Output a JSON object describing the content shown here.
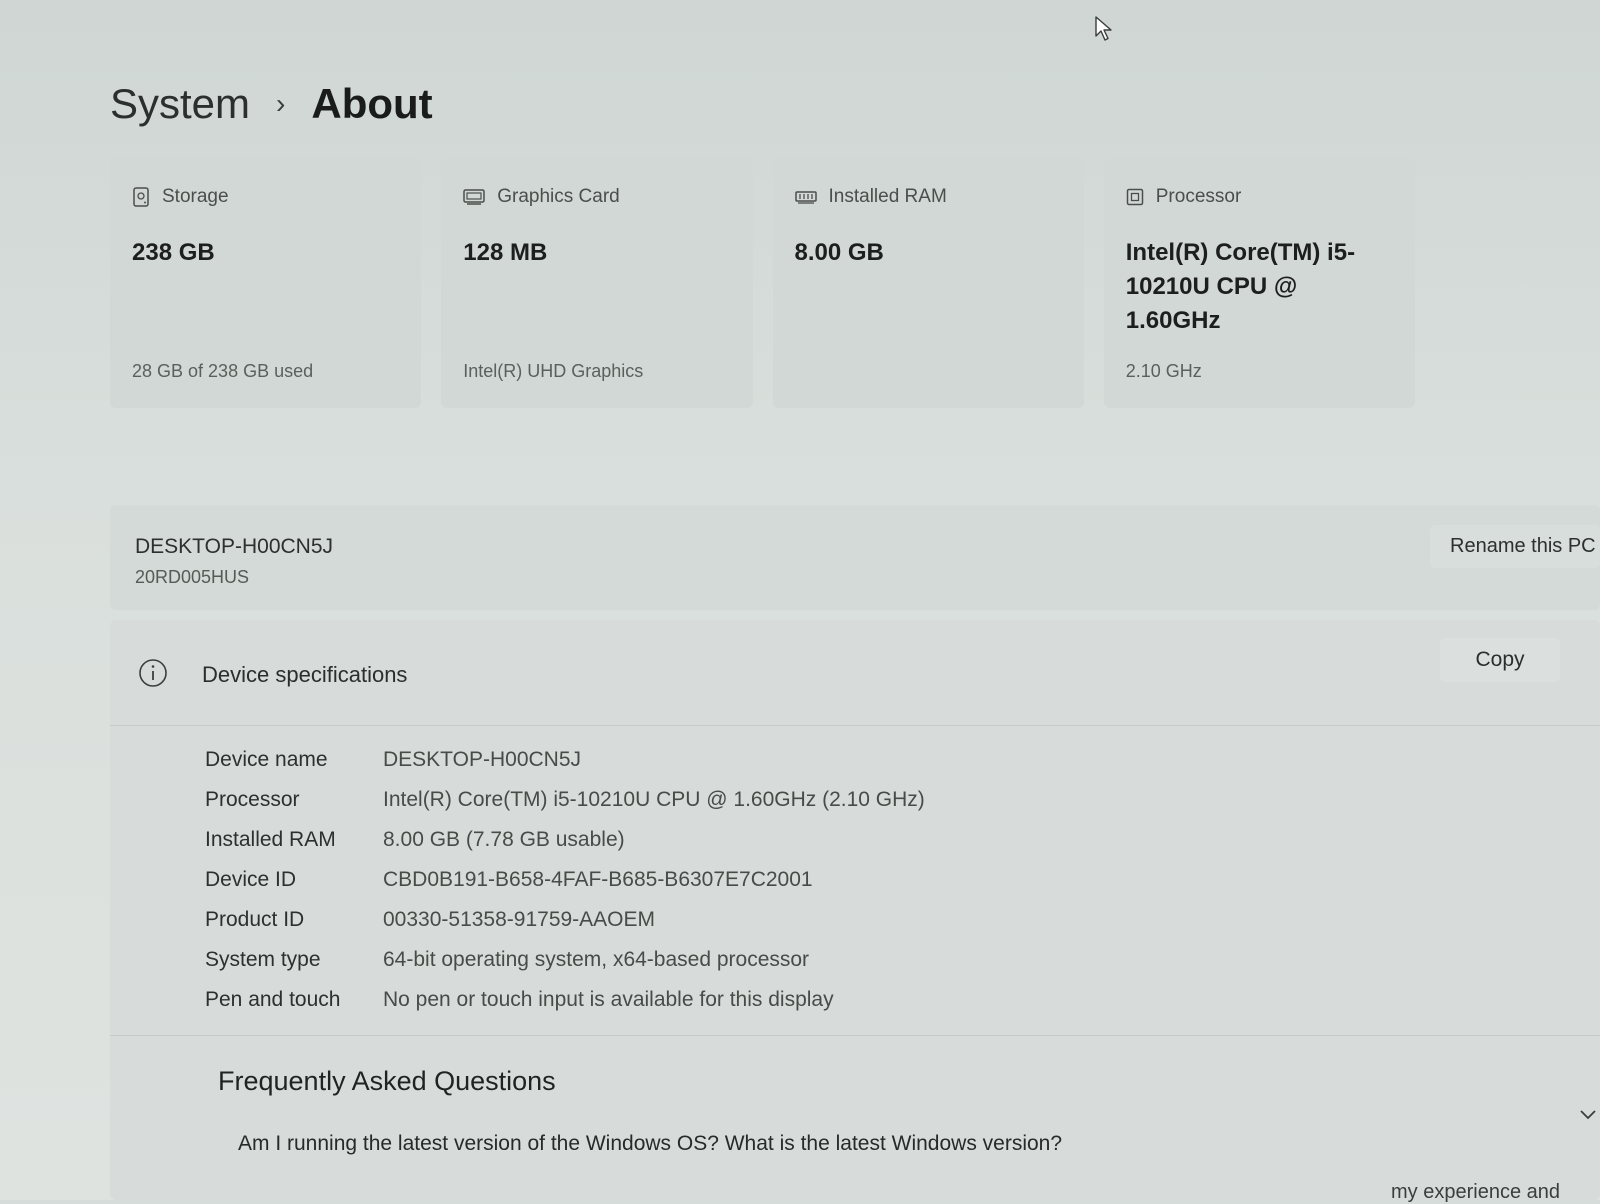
{
  "breadcrumb": {
    "parent": "System",
    "separator": "›",
    "current": "About"
  },
  "cards": [
    {
      "label": "Storage",
      "icon": "storage-icon",
      "value": "238 GB",
      "sub": "28 GB of 238 GB used"
    },
    {
      "label": "Graphics Card",
      "icon": "graphics-card-icon",
      "value": "128 MB",
      "sub": "Intel(R) UHD Graphics"
    },
    {
      "label": "Installed RAM",
      "icon": "ram-icon",
      "value": "8.00 GB",
      "sub": ""
    },
    {
      "label": "Processor",
      "icon": "processor-icon",
      "value": "Intel(R) Core(TM) i5-10210U CPU @ 1.60GHz",
      "sub": "2.10 GHz"
    }
  ],
  "device": {
    "name": "DESKTOP-H00CN5J",
    "model": "20RD005HUS",
    "rename_label": "Rename this PC"
  },
  "specs": {
    "title": "Device specifications",
    "copy_label": "Copy",
    "rows": [
      {
        "label": "Device name",
        "value": "DESKTOP-H00CN5J"
      },
      {
        "label": "Processor",
        "value": "Intel(R) Core(TM) i5-10210U CPU @ 1.60GHz (2.10 GHz)"
      },
      {
        "label": "Installed RAM",
        "value": "8.00 GB (7.78 GB usable)"
      },
      {
        "label": "Device ID",
        "value": "CBD0B191-B658-4FAF-B685-B6307E7C2001"
      },
      {
        "label": "Product ID",
        "value": "00330-51358-91759-AAOEM"
      },
      {
        "label": "System type",
        "value": "64-bit operating system, x64-based processor"
      },
      {
        "label": "Pen and touch",
        "value": "No pen or touch input is available for this display"
      }
    ]
  },
  "faq": {
    "title": "Frequently Asked Questions",
    "question": "Am I running the latest version of the Windows OS? What is the latest Windows version?",
    "answer_partial": "my experience and"
  }
}
